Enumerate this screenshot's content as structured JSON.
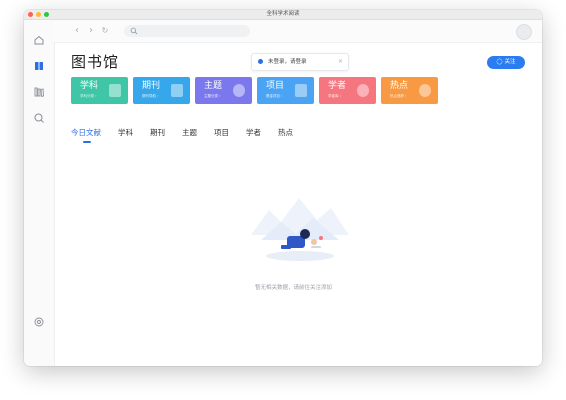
{
  "window": {
    "title": "全科学术阅读"
  },
  "sidebar": {
    "items": [
      {
        "name": "home",
        "icon": "home-icon"
      },
      {
        "name": "library",
        "icon": "book-icon",
        "active": true
      },
      {
        "name": "shelf",
        "icon": "bookshelf-icon"
      },
      {
        "name": "search",
        "icon": "search-icon"
      }
    ],
    "bottom_icon": "settings-icon"
  },
  "page": {
    "title": "图书馆"
  },
  "notice": {
    "text": "未登录，请登录"
  },
  "follow_button": {
    "label": "◯ 关注"
  },
  "cards": [
    {
      "label": "学科",
      "sub": "学科分类 ›",
      "color": "#3ec6a6",
      "icon": "document-icon"
    },
    {
      "label": "期刊",
      "sub": "期刊导航 ›",
      "color": "#36a7ea",
      "icon": "journal-icon"
    },
    {
      "label": "主题",
      "sub": "主题分类 ›",
      "color": "#7b78ee",
      "icon": "sparkle-icon"
    },
    {
      "label": "项目",
      "sub": "基金项目 ›",
      "color": "#4aa3f3",
      "icon": "file-icon"
    },
    {
      "label": "学者",
      "sub": "学者库 ›",
      "color": "#f5767f",
      "icon": "person-icon"
    },
    {
      "label": "热点",
      "sub": "热点追踪 ›",
      "color": "#f79a43",
      "icon": "fire-icon"
    }
  ],
  "tabs": [
    "今日文献",
    "学科",
    "期刊",
    "主题",
    "项目",
    "学者",
    "热点"
  ],
  "empty_state": {
    "text": "暂无相关数据，请前往关注添加"
  }
}
